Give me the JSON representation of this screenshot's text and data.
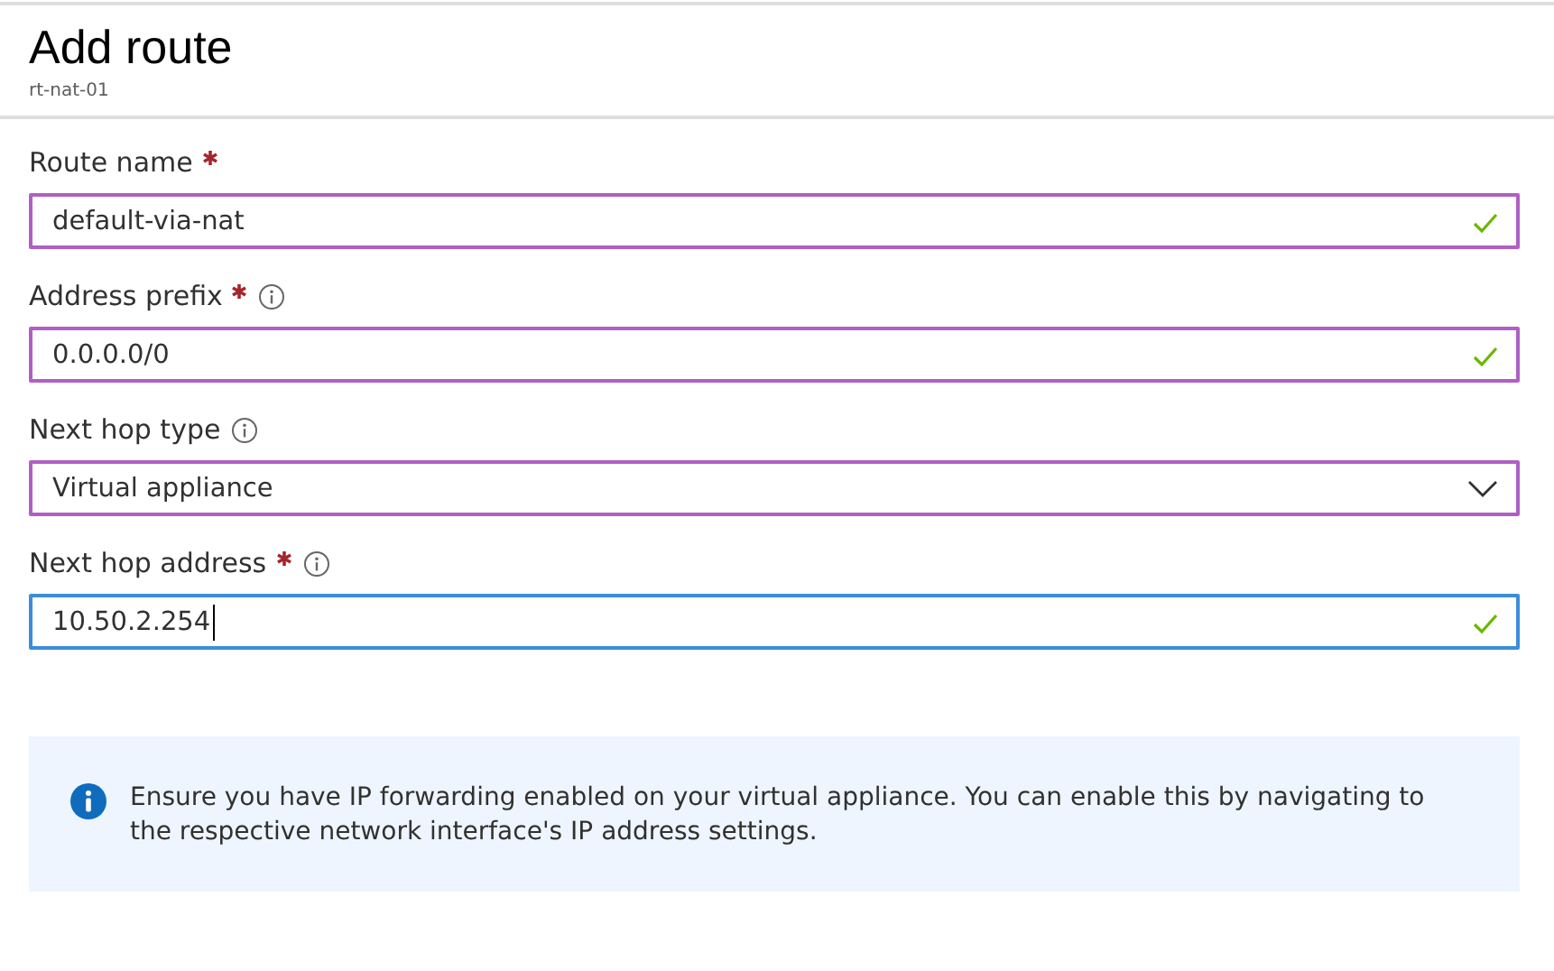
{
  "header": {
    "title": "Add route",
    "subtitle": "rt-nat-01"
  },
  "fields": [
    {
      "kind": "text",
      "label": "Route name",
      "required": true,
      "info": false,
      "value": "default-via-nat",
      "valid": true,
      "focused": false
    },
    {
      "kind": "text",
      "label": "Address prefix",
      "required": true,
      "info": true,
      "value": "0.0.0.0/0",
      "valid": true,
      "focused": false
    },
    {
      "kind": "dropdown",
      "label": "Next hop type",
      "required": false,
      "info": true,
      "value": "Virtual appliance",
      "valid": false,
      "focused": false
    },
    {
      "kind": "text",
      "label": "Next hop address",
      "required": true,
      "info": true,
      "value": "10.50.2.254",
      "valid": true,
      "focused": true
    }
  ],
  "info_box": {
    "text": "Ensure you have IP forwarding enabled on your virtual appliance. You can enable this by navigating to the respective network interface's IP address settings."
  }
}
